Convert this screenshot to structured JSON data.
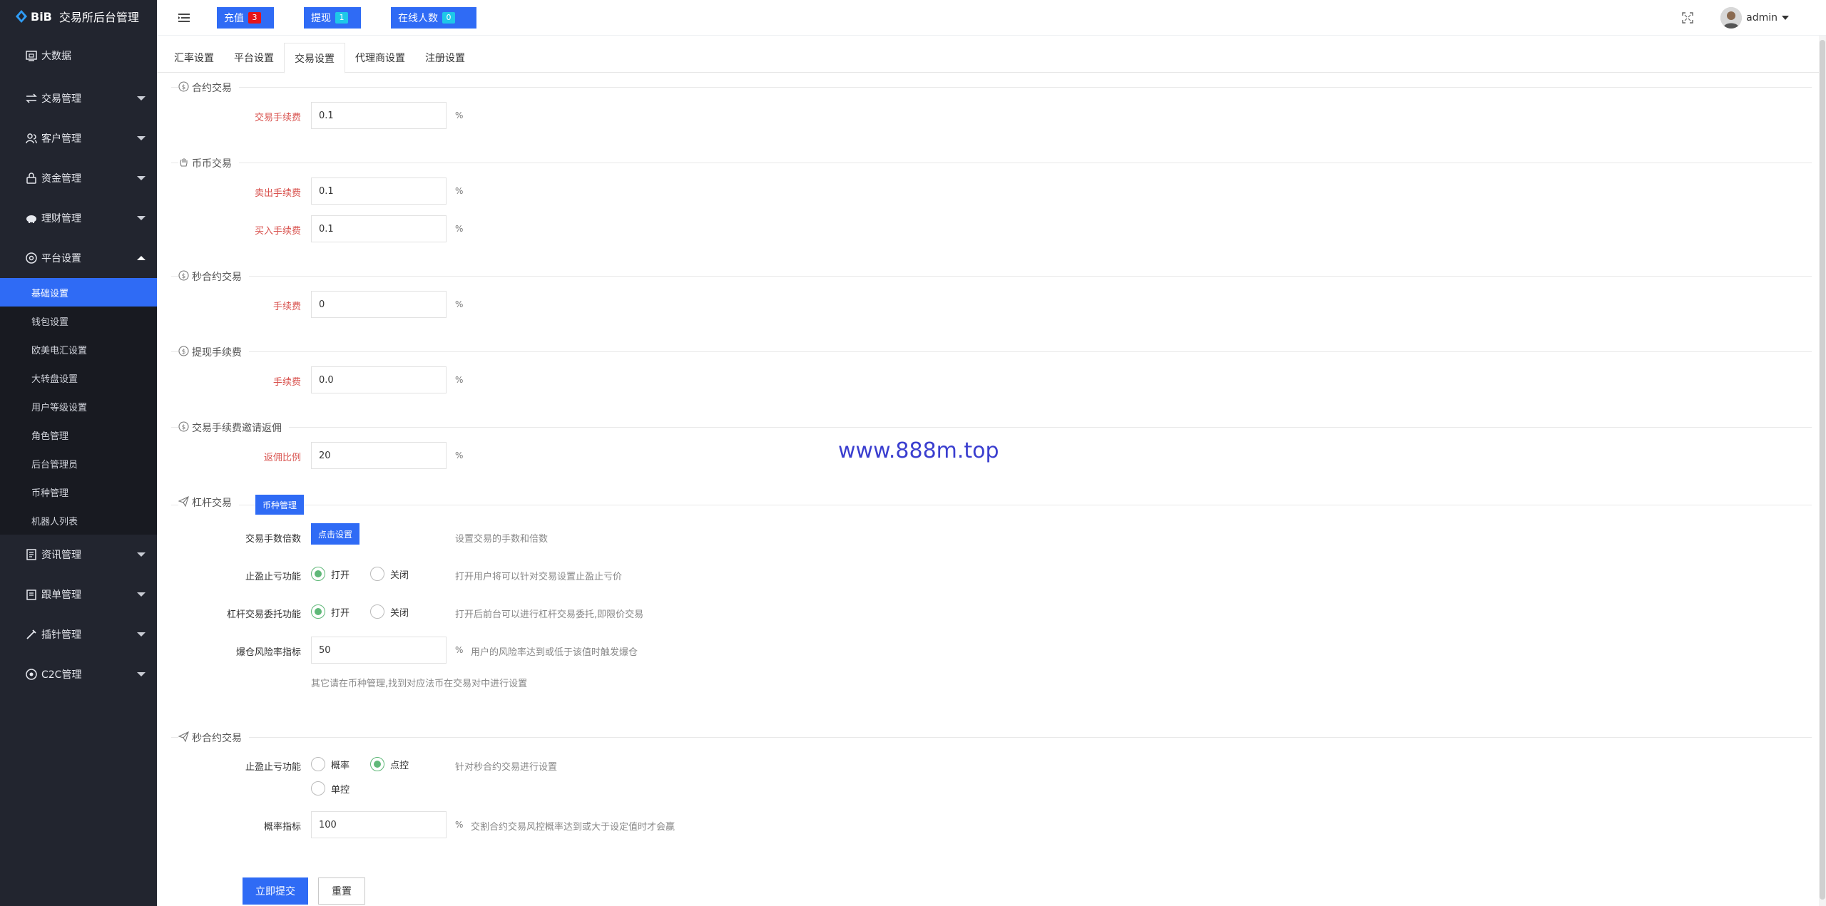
{
  "brand": {
    "logo_text": "BiB",
    "title": "交易所后台管理"
  },
  "sidebar": {
    "items": [
      {
        "label": "大数据",
        "icon": "dashboard-icon"
      },
      {
        "label": "交易管理",
        "icon": "exchange-icon"
      },
      {
        "label": "客户管理",
        "icon": "users-icon"
      },
      {
        "label": "资金管理",
        "icon": "lock-icon"
      },
      {
        "label": "理财管理",
        "icon": "piggy-bank-icon"
      },
      {
        "label": "平台设置",
        "icon": "target-icon"
      }
    ],
    "subitems": [
      "基础设置",
      "钱包设置",
      "欧美电汇设置",
      "大转盘设置",
      "用户等级设置",
      "角色管理",
      "后台管理员",
      "币种管理",
      "机器人列表"
    ],
    "active_subitem": "基础设置",
    "items_after": [
      {
        "label": "资讯管理",
        "icon": "news-icon"
      },
      {
        "label": "跟单管理",
        "icon": "copy-order-icon"
      },
      {
        "label": "插针管理",
        "icon": "needle-icon"
      },
      {
        "label": "C2C管理",
        "icon": "c2c-icon"
      }
    ]
  },
  "header": {
    "recharge": {
      "label": "充值",
      "count": "3"
    },
    "withdraw": {
      "label": "提现",
      "count": "1"
    },
    "online": {
      "label": "在线人数",
      "count": "0"
    },
    "user": "admin"
  },
  "tabs": [
    "汇率设置",
    "平台设置",
    "交易设置",
    "代理商设置",
    "注册设置"
  ],
  "active_tab": "交易设置",
  "form": {
    "contract": {
      "title": "合约交易",
      "fee_label": "交易手续费",
      "fee_value": "0.1",
      "unit": "%"
    },
    "spot": {
      "title": "币币交易",
      "sell_label": "卖出手续费",
      "sell_value": "0.1",
      "buy_label": "买入手续费",
      "buy_value": "0.1",
      "unit": "%"
    },
    "second_contract": {
      "title": "秒合约交易",
      "fee_label": "手续费",
      "fee_value": "0",
      "unit": "%"
    },
    "withdraw_fee": {
      "title": "提现手续费",
      "fee_label": "手续费",
      "fee_value": "0.0",
      "unit": "%"
    },
    "invite_rebate": {
      "title": "交易手续费邀请返佣",
      "label": "返佣比例",
      "value": "20",
      "unit": "%"
    },
    "leverage": {
      "title": "杠杆交易",
      "coin_btn": "币种管理",
      "multiple_label": "交易手数倍数",
      "multiple_btn": "点击设置",
      "multiple_hint": "设置交易的手数和倍数",
      "tpsl_label": "止盈止亏功能",
      "tpsl_on": "打开",
      "tpsl_off": "关闭",
      "tpsl_hint": "打开用户将可以针对交易设置止盈止亏价",
      "entrust_label": "杠杆交易委托功能",
      "entrust_on": "打开",
      "entrust_off": "关闭",
      "entrust_hint": "打开后前台可以进行杠杆交易委托,即限价交易",
      "risk_label": "爆仓风险率指标",
      "risk_value": "50",
      "risk_unit": "%",
      "risk_hint": "用户的风险率达到或低于该值时触发爆仓",
      "note": "其它请在币种管理,找到对应法币在交易对中进行设置"
    },
    "second_contract2": {
      "title": "秒合约交易",
      "tpsl_label": "止盈止亏功能",
      "opt_probability": "概率",
      "opt_point": "点控",
      "opt_single": "单控",
      "tpsl_hint": "针对秒合约交易进行设置",
      "prob_label": "概率指标",
      "prob_value": "100",
      "prob_unit": "%",
      "prob_hint": "交割合约交易风控概率达到或大于设定值时才会赢"
    },
    "submit": "立即提交",
    "reset": "重置"
  },
  "watermark": "www.888m.top",
  "colors": {
    "accent": "#2f6bf5",
    "sidebar_bg": "#22252f",
    "radio_checked": "#5fb878",
    "label_red": "#d9534f"
  }
}
